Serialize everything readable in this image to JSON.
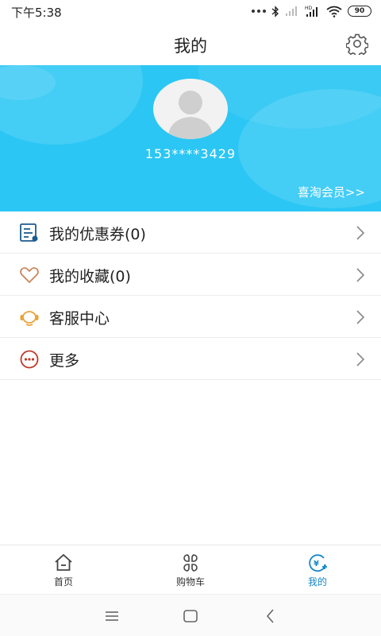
{
  "status_bar": {
    "time": "下午5:38",
    "battery": "90"
  },
  "header": {
    "title": "我的"
  },
  "profile": {
    "phone": "153****3429",
    "member_link": "喜淘会员>>"
  },
  "menu": {
    "items": [
      {
        "label": "我的优惠券(0)",
        "icon": "coupon-icon"
      },
      {
        "label": "我的收藏(0)",
        "icon": "heart-icon"
      },
      {
        "label": "客服中心",
        "icon": "customer-service-icon"
      },
      {
        "label": "更多",
        "icon": "more-icon"
      }
    ]
  },
  "tabs": [
    {
      "label": "首页",
      "icon": "home-icon",
      "active": false
    },
    {
      "label": "购物车",
      "icon": "cart-icon",
      "active": false
    },
    {
      "label": "我的",
      "icon": "profile-icon",
      "active": true
    }
  ],
  "colors": {
    "banner": "#2bc6f4",
    "accent": "#1687c7",
    "coupon_icon": "#1e5b8f",
    "heart_icon": "#c8855a",
    "service_icon": "#e8a33a",
    "more_icon": "#c0392b"
  }
}
